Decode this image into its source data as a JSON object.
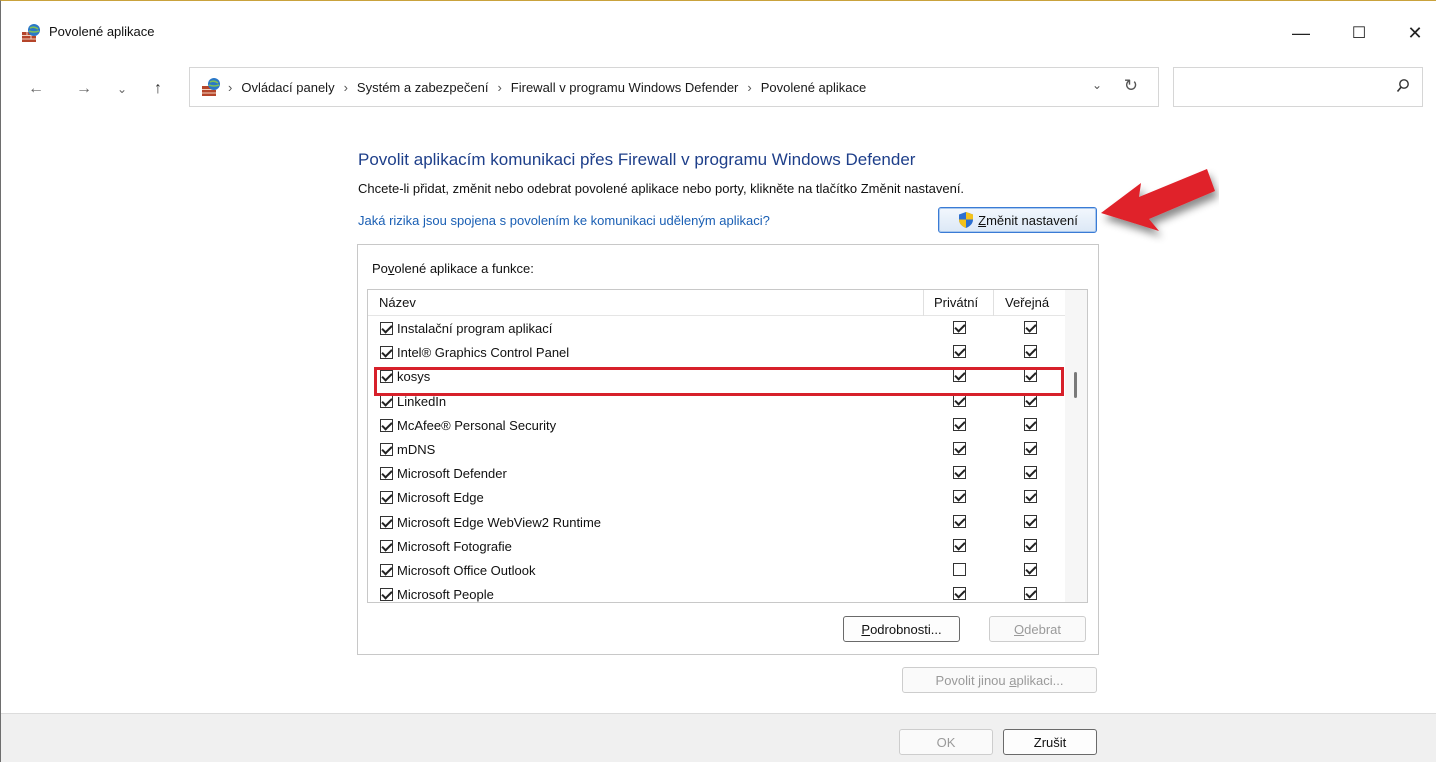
{
  "window": {
    "title": "Povolené aplikace",
    "minimize_glyph": "—",
    "maximize_glyph": "☐",
    "close_glyph": "✕"
  },
  "nav": {
    "back_glyph": "←",
    "forward_glyph": "→",
    "history_glyph": "⌄",
    "up_glyph": "↑",
    "breadcrumb": [
      "Ovládací panely",
      "Systém a zabezpečení",
      "Firewall v programu Windows Defender",
      "Povolené aplikace"
    ],
    "separator": "›",
    "dropdown_glyph": "⌄",
    "refresh_glyph": "↻",
    "search_placeholder": ""
  },
  "content": {
    "heading": "Povolit aplikacím komunikaci přes Firewall v programu Windows Defender",
    "subtitle": "Chcete-li přidat, změnit nebo odebrat povolené aplikace nebo porty, klikněte na tlačítko Změnit nastavení.",
    "risk_link": "Jaká rizika jsou spojena s povolením ke komunikaci uděleným aplikaci?",
    "change_button": {
      "accel": "Z",
      "rest": "měnit nastavení"
    },
    "group_label": {
      "pre": "Po",
      "accel": "v",
      "post": "olené aplikace a funkce:"
    },
    "columns": {
      "name": "Název",
      "private": "Privátní",
      "public": "Veřejná"
    },
    "apps": [
      {
        "name": "Instalační program aplikací",
        "enabled": true,
        "private": true,
        "public": true
      },
      {
        "name": "Intel® Graphics Control Panel",
        "enabled": true,
        "private": true,
        "public": true
      },
      {
        "name": "kosys",
        "enabled": true,
        "private": true,
        "public": true
      },
      {
        "name": "LinkedIn",
        "enabled": true,
        "private": true,
        "public": true
      },
      {
        "name": "McAfee® Personal Security",
        "enabled": true,
        "private": true,
        "public": true
      },
      {
        "name": "mDNS",
        "enabled": true,
        "private": true,
        "public": true
      },
      {
        "name": "Microsoft Defender",
        "enabled": true,
        "private": true,
        "public": true
      },
      {
        "name": "Microsoft Edge",
        "enabled": true,
        "private": true,
        "public": true
      },
      {
        "name": "Microsoft Edge WebView2 Runtime",
        "enabled": true,
        "private": true,
        "public": true
      },
      {
        "name": "Microsoft Fotografie",
        "enabled": true,
        "private": true,
        "public": true
      },
      {
        "name": "Microsoft Office Outlook",
        "enabled": true,
        "private": false,
        "public": true
      },
      {
        "name": "Microsoft People",
        "enabled": true,
        "private": true,
        "public": true
      }
    ],
    "details_button": {
      "accel": "P",
      "rest": "odrobnosti..."
    },
    "remove_button": {
      "accel": "O",
      "rest": "debrat"
    },
    "allow_other_button": {
      "pre": "Povolit jinou ",
      "accel": "a",
      "post": "plikaci..."
    }
  },
  "footer": {
    "ok": "OK",
    "cancel": "Zrušit"
  },
  "colors": {
    "heading": "#1e3f8a",
    "link": "#1a5fb4",
    "highlight": "#d7202a",
    "arrow": "#e0202a"
  }
}
